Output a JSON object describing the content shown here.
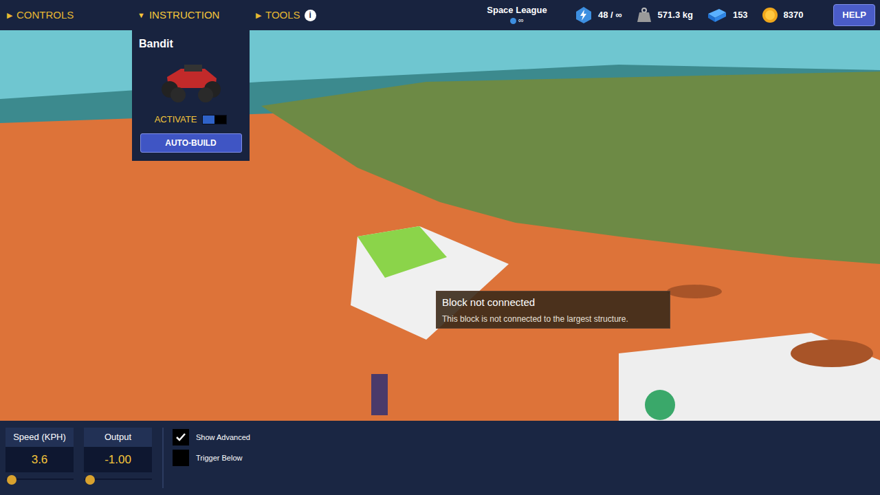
{
  "top_bar": {
    "menus": [
      {
        "label": "CONTROLS",
        "arrow": "▶",
        "expanded": false
      },
      {
        "label": "INSTRUCTION",
        "arrow": "▼",
        "expanded": true
      },
      {
        "label": "TOOLS",
        "arrow": "▶",
        "expanded": false
      }
    ],
    "tools_info": "i",
    "league": {
      "name": "Space League",
      "rank": "∞"
    },
    "resources": [
      {
        "kind": "energy",
        "value": "48 / ∞"
      },
      {
        "kind": "weight",
        "value": "571.3 kg"
      },
      {
        "kind": "blocks",
        "value": "153"
      },
      {
        "kind": "coins",
        "value": "8370"
      }
    ],
    "help": "HELP"
  },
  "instruction_panel": {
    "title": "Bandit",
    "activate": {
      "label": "ACTIVATE",
      "on": true
    },
    "button": "AUTO-BUILD"
  },
  "tooltip": {
    "title": "Block not connected",
    "text": "This block is not connected to the largest structure."
  },
  "bottom_panel": {
    "sliders": [
      {
        "label": "Speed (KPH)",
        "value": "3.6",
        "level": 0.02
      },
      {
        "label": "Output",
        "value": "-1.00",
        "level": 0.02
      }
    ],
    "checkboxes": [
      {
        "label": "Show Advanced",
        "checked": true
      },
      {
        "label": "Trigger Below",
        "checked": false
      }
    ]
  }
}
